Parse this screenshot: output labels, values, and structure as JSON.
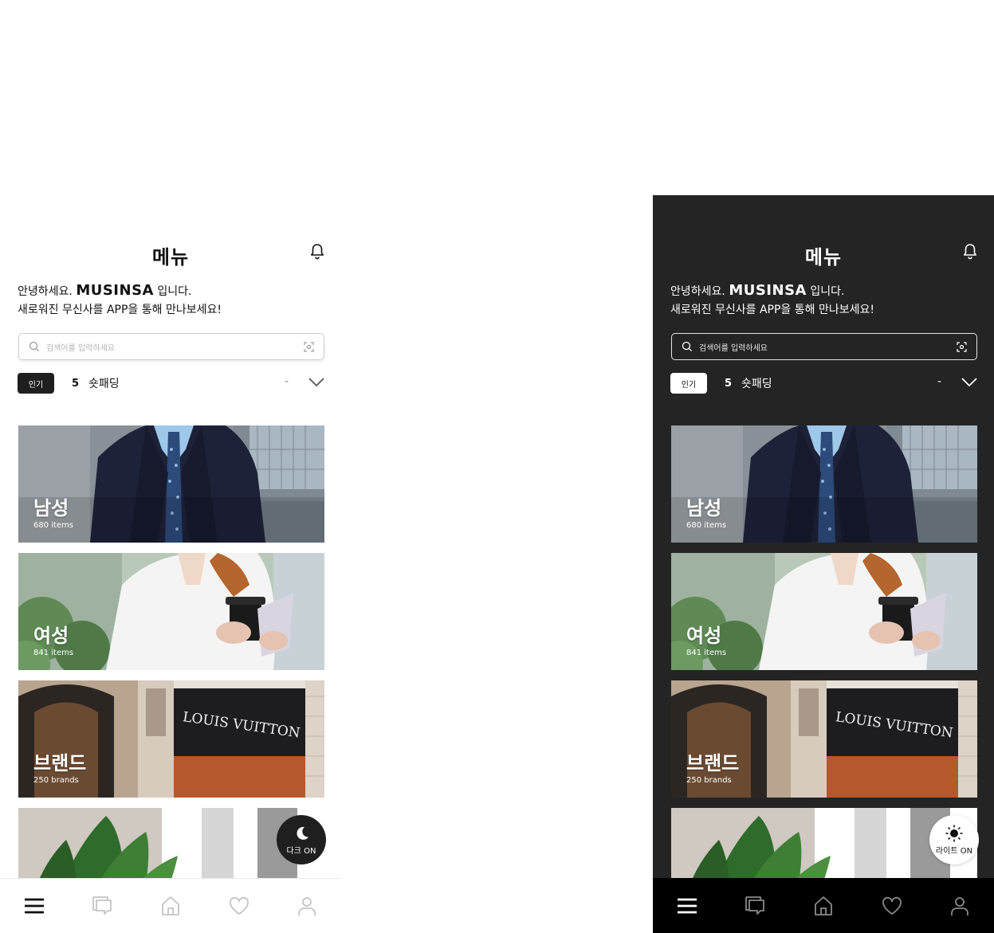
{
  "light": {
    "header": {
      "title": "메뉴"
    },
    "greeting": {
      "line1_prefix": "안녕하세요.",
      "brand": "MUSINSA",
      "line1_suffix": "입니다.",
      "line2": "새로워진 무신사를 APP을 통해 만나보세요!"
    },
    "search": {
      "placeholder": "검색어를 입력하세요"
    },
    "trending": {
      "badge": "인기",
      "rank": "5",
      "keyword": "숏패딩",
      "change": "-"
    },
    "categories": [
      {
        "name": "남성",
        "count": "680 items"
      },
      {
        "name": "여성",
        "count": "841 items"
      },
      {
        "name": "브랜드",
        "count": "250 brands"
      }
    ],
    "theme_toggle": {
      "label": "다크 ON"
    }
  },
  "dark": {
    "header": {
      "title": "메뉴"
    },
    "greeting": {
      "line1_prefix": "안녕하세요.",
      "brand": "MUSINSA",
      "line1_suffix": "입니다.",
      "line2": "새로워진 무신사를 APP을 통해 만나보세요!"
    },
    "search": {
      "placeholder": "검색어를 입력하세요"
    },
    "trending": {
      "badge": "인기",
      "rank": "5",
      "keyword": "숏패딩",
      "change": "-"
    },
    "categories": [
      {
        "name": "남성",
        "count": "680 items"
      },
      {
        "name": "여성",
        "count": "841 items"
      },
      {
        "name": "브랜드",
        "count": "250 brands"
      }
    ],
    "theme_toggle": {
      "label": "라이트 ON"
    }
  },
  "store_sign": "LOUIS VUITTON",
  "icons": [
    "bell-icon",
    "search-icon",
    "scan-icon",
    "chevron-down-icon",
    "moon-icon",
    "sun-icon",
    "menu-icon",
    "chat-icon",
    "home-icon",
    "heart-icon",
    "user-icon"
  ],
  "colors": {
    "dark_bg": "#242424",
    "dark_tabbar": "#000000",
    "light_bg": "#ffffff",
    "accent_dark": "#1f1f1f"
  }
}
